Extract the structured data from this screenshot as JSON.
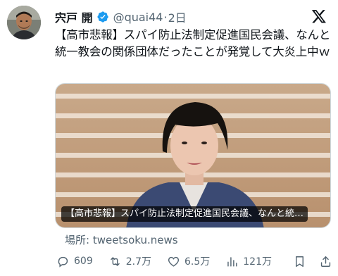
{
  "tweet": {
    "display_name": "宍戸 開",
    "handle": "@quai44",
    "separator": "·",
    "time": "2日",
    "text": "【高市悲報】スパイ防止法制定促進国民会議、なんと統一教会の関係団体だったことが発覚して大炎上中ｗ",
    "card": {
      "caption": "【高市悲報】スパイ防止法制定促進国民会議、なんと統…",
      "source_label": "場所: tweetsoku.news"
    },
    "stats": {
      "replies": "609",
      "retweets": "2.7万",
      "likes": "6.5万",
      "views": "121万"
    }
  },
  "icons": {
    "verified": "verified-badge-icon",
    "x_logo": "x-logo-icon",
    "reply": "reply-icon",
    "retweet": "retweet-icon",
    "like": "heart-icon",
    "views": "views-icon",
    "bookmark": "bookmark-icon",
    "share": "share-icon"
  },
  "colors": {
    "verified": "#1d9bf0",
    "text": "#0f1419",
    "muted": "#536471"
  }
}
